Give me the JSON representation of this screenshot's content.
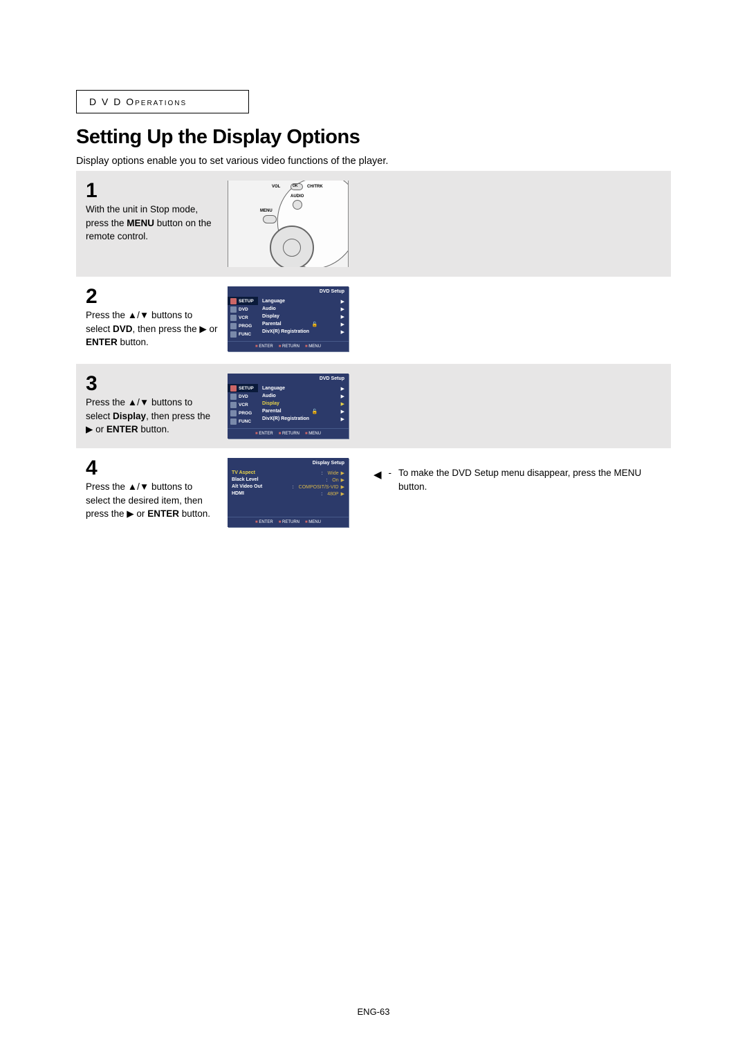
{
  "section": {
    "header": "D V D  Operations"
  },
  "title": "Setting Up the Display Options",
  "intro": "Display options enable you to set various video functions of the player.",
  "steps": {
    "s1": {
      "num": "1",
      "text_a": "With the unit in Stop mode, press the ",
      "text_b": " button on the remote control.",
      "bold": "MENU",
      "remote": {
        "vol": "VOL",
        "ok": "OK",
        "chtrk": "CH/TRK",
        "audio": "AUDIO",
        "menu": "MENU"
      }
    },
    "s2": {
      "num": "2",
      "text_a": "Press the ",
      "text_b": " buttons to select ",
      "text_c": ", then press the ",
      "text_d": " or ",
      "text_e": " button.",
      "bold_a": "DVD",
      "bold_b": "ENTER"
    },
    "s3": {
      "num": "3",
      "text_a": "Press the ",
      "text_b": " buttons to select ",
      "text_c": ", then press the ",
      "text_d": " or ",
      "text_e": " button.",
      "bold_a": "Display",
      "bold_b": "ENTER"
    },
    "s4": {
      "num": "4",
      "text_a": "Press the ",
      "text_b": " buttons to select the desired item, then press the ",
      "text_c": " or ",
      "text_d": " button.",
      "bold_b": "ENTER"
    }
  },
  "osd_dvd": {
    "title": "DVD Setup",
    "side": [
      "SETUP",
      "DVD",
      "VCR",
      "PROG",
      "FUNC"
    ],
    "items": [
      "Language",
      "Audio",
      "Display",
      "Parental",
      "DivX(R) Registration"
    ],
    "footer": [
      "ENTER",
      "RETURN",
      "MENU"
    ]
  },
  "osd_display": {
    "title": "Display Setup",
    "rows": [
      {
        "label": "TV Aspect",
        "value": "Wide"
      },
      {
        "label": "Black Level",
        "value": "On"
      },
      {
        "label": "Alt Video Out",
        "value": "COMPOSIT/S-VID"
      },
      {
        "label": "HDMI",
        "value": "480P"
      }
    ],
    "footer": [
      "ENTER",
      "RETURN",
      "MENU"
    ]
  },
  "note": {
    "text": "To make the DVD Setup menu disappear, press the MENU button."
  },
  "page": "ENG-63"
}
